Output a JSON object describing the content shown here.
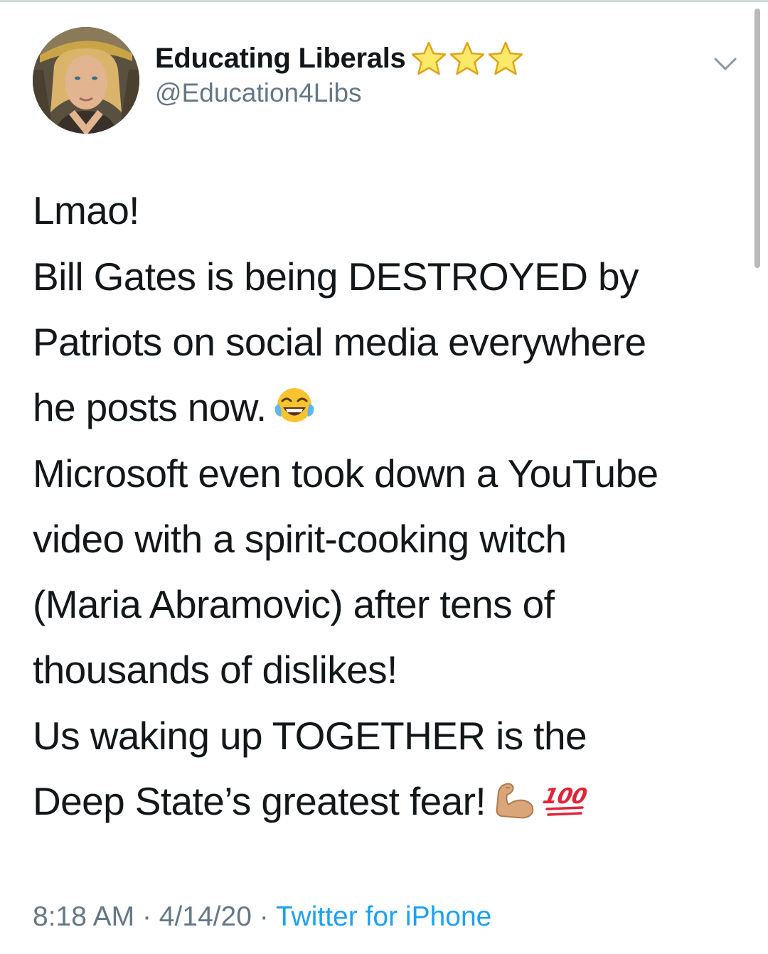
{
  "tweet": {
    "author": {
      "display_name": "Educating Liberals",
      "handle": "@Education4Libs",
      "badges": [
        "star-icon",
        "star-icon",
        "star-icon"
      ]
    },
    "menu_icon": "chevron-down-icon",
    "text_lines": [
      [
        "Lmao!"
      ],
      [
        "Bill Gates is being DESTROYED by",
        "Patriots on social media everywhere",
        "he posts now."
      ],
      [
        "Microsoft even took down a YouTube",
        "video with a spirit-cooking witch",
        "(Maria Abramovic) after tens of",
        "thousands of dislikes!"
      ],
      [
        "Us waking up TOGETHER is the",
        "Deep State’s greatest fear!"
      ]
    ],
    "emojis": [
      "face-with-tears-of-joy-icon",
      "flexed-biceps-icon",
      "hundred-points-icon"
    ],
    "time": "8:18 AM",
    "date": "4/14/20",
    "separator": "·",
    "source": "Twitter for iPhone"
  },
  "colors": {
    "text": "#14171a",
    "secondary": "#657786",
    "link": "#1da1f2",
    "star": "#f5c518"
  }
}
